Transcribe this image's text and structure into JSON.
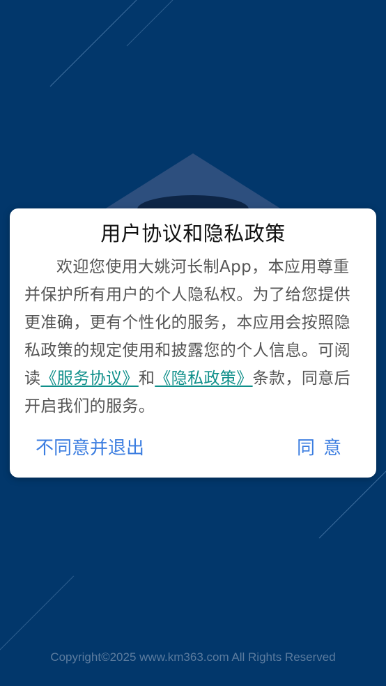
{
  "dialog": {
    "title": "用户协议和隐私政策",
    "body_text_1": "欢迎您使用大姚河长制App，本应用尊重并保护所有用户的个人隐私权。为了给您提供更准确，更有个性化的服务，本应用会按照隐私政策的规定使用和披露您的个人信息。可阅读",
    "service_agreement_link": "《服务协议》",
    "body_text_2": "和",
    "privacy_policy_link": "《隐私政策》",
    "body_text_3": "条款，同意后开启我们的服务。",
    "decline_label": "不同意并退出",
    "agree_label": "同意"
  },
  "footer": {
    "copyright": "Copyright©2025 www.km363.com All Rights Reserved"
  },
  "colors": {
    "background": "#02376b",
    "link": "#0f8f8a",
    "button": "#3b7de0"
  }
}
